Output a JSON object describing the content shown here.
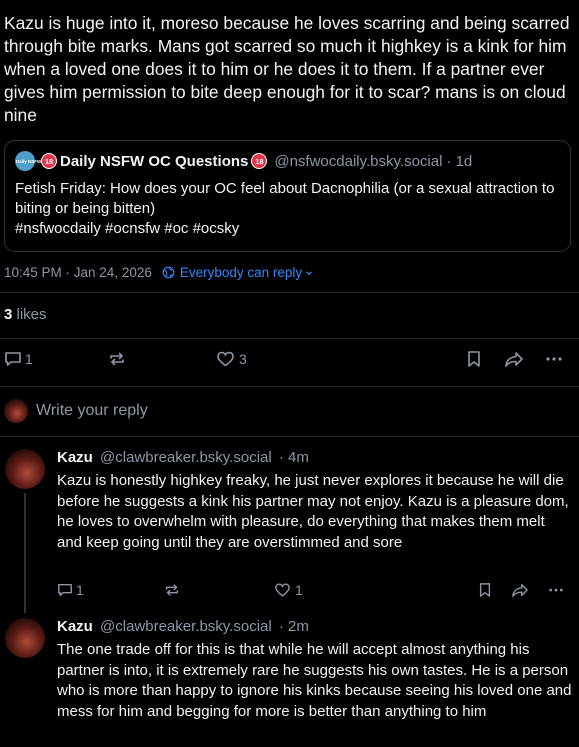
{
  "post": {
    "text": "Kazu is huge into it, moreso because he loves scarring and being scarred through bite marks. Mans got scarred so much it highkey is a kink for him when a loved one does it to him or he does it to them. If a partner ever gives him permission to bite deep enough for it to scar? mans is on cloud nine",
    "timestamp": "10:45 PM · Jan 24, 2026",
    "reply_setting": "Everybody can reply",
    "likes_count": "3",
    "likes_label": "likes",
    "reply_count": "1",
    "like_count": "3"
  },
  "quote": {
    "avatar_text": "Daily NSFW",
    "emoji": "18",
    "display_name": "Daily NSFW OC Questions",
    "handle": "@nsfwocdaily.bsky.social",
    "time": "· 1d",
    "text": "Fetish Friday: How does your OC feel about Dacnophilia (or a sexual attraction to biting or being bitten)",
    "tags": "#nsfwocdaily #ocnsfw #oc #ocsky"
  },
  "composer": {
    "placeholder": "Write your reply"
  },
  "replies": [
    {
      "name": "Kazu",
      "handle": "@clawbreaker.bsky.social",
      "time": "· 4m",
      "text": "Kazu is honestly highkey freaky, he just never explores it because he will die before he suggests a kink his partner may not enjoy. Kazu is a pleasure dom, he loves to overwhelm with pleasure, do everything that makes them melt and keep going until they are overstimmed and sore",
      "reply_count": "1",
      "like_count": "1"
    },
    {
      "name": "Kazu",
      "handle": "@clawbreaker.bsky.social",
      "time": "· 2m",
      "text": "The one trade off for this is that while he will accept almost anything his partner is into, it is extremely rare he suggests his own tastes. He is a person who is more than happy to ignore his kinks because seeing his loved one and mess for him and begging for more is better than anything to him"
    }
  ],
  "colors": {
    "background": "#000000",
    "text": "#f1f3f5",
    "muted": "#8b98a5",
    "accent": "#2f88ff",
    "border": "#2e3338"
  },
  "icons": {
    "reply": "reply-icon",
    "repost": "repost-icon",
    "like": "heart-icon",
    "bookmark": "bookmark-icon",
    "share": "share-icon",
    "more": "more-icon",
    "globe": "globe-icon",
    "chevron": "chevron-down-icon"
  }
}
